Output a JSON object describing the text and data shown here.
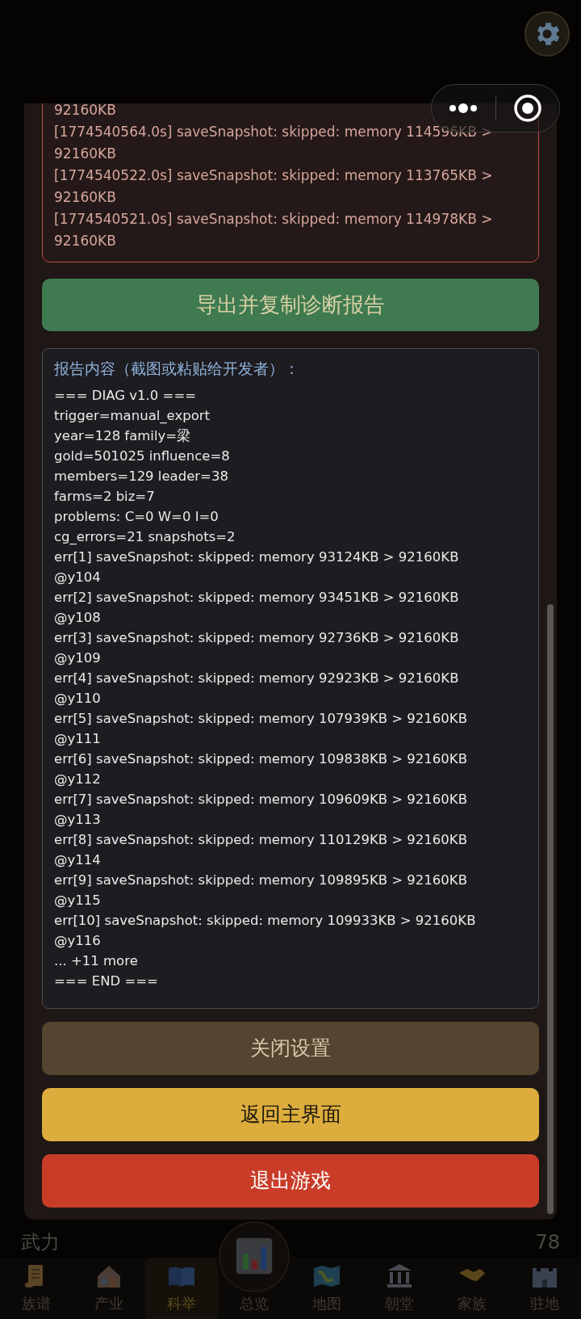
{
  "background": {
    "stat": {
      "label": "武力",
      "value": "78"
    }
  },
  "settings_panel": {
    "log_lines": [
      "92160KB",
      "[1774540564.0s] saveSnapshot: skipped: memory 114596KB > 92160KB",
      "[1774540522.0s] saveSnapshot: skipped: memory 113765KB > 92160KB",
      "[1774540521.0s] saveSnapshot: skipped: memory 114978KB > 92160KB"
    ],
    "export_button": "导出并复制诊断报告",
    "report": {
      "heading": "报告内容（截图或粘贴给开发者）：",
      "lines": [
        "=== DIAG v1.0 ===",
        "trigger=manual_export",
        "year=128 family=梁",
        "gold=501025 influence=8",
        "members=129 leader=38",
        "farms=2 biz=7",
        "problems: C=0 W=0 I=0",
        "cg_errors=21 snapshots=2",
        "err[1] saveSnapshot: skipped: memory 93124KB > 92160KB",
        "@y104",
        "err[2] saveSnapshot: skipped: memory 93451KB > 92160KB",
        "@y108",
        "err[3] saveSnapshot: skipped: memory 92736KB > 92160KB",
        "@y109",
        "err[4] saveSnapshot: skipped: memory 92923KB > 92160KB",
        "@y110",
        "err[5] saveSnapshot: skipped: memory 107939KB > 92160KB",
        "@y111",
        "err[6] saveSnapshot: skipped: memory 109838KB > 92160KB",
        "@y112",
        "err[7] saveSnapshot: skipped: memory 109609KB > 92160KB",
        "@y113",
        "err[8] saveSnapshot: skipped: memory 110129KB > 92160KB",
        "@y114",
        "err[9] saveSnapshot: skipped: memory 109895KB > 92160KB",
        "@y115",
        "err[10] saveSnapshot: skipped: memory 109933KB > 92160KB",
        "@y116",
        "... +11 more",
        "=== END ==="
      ]
    },
    "buttons": [
      {
        "label": "关闭设置",
        "kind": "close"
      },
      {
        "label": "返回主界面",
        "kind": "home"
      },
      {
        "label": "退出游戏",
        "kind": "exit"
      }
    ]
  },
  "nav": [
    {
      "label": "族谱",
      "kind": "scroll",
      "selected": false
    },
    {
      "label": "产业",
      "kind": "house",
      "selected": false
    },
    {
      "label": "科举",
      "kind": "book",
      "selected": true
    },
    {
      "label": "总览",
      "kind": "chart",
      "selected": false
    },
    {
      "label": "地图",
      "kind": "map",
      "selected": false
    },
    {
      "label": "朝堂",
      "kind": "hall",
      "selected": false
    },
    {
      "label": "家族",
      "kind": "handshake",
      "selected": false
    },
    {
      "label": "驻地",
      "kind": "castle",
      "selected": false
    }
  ]
}
